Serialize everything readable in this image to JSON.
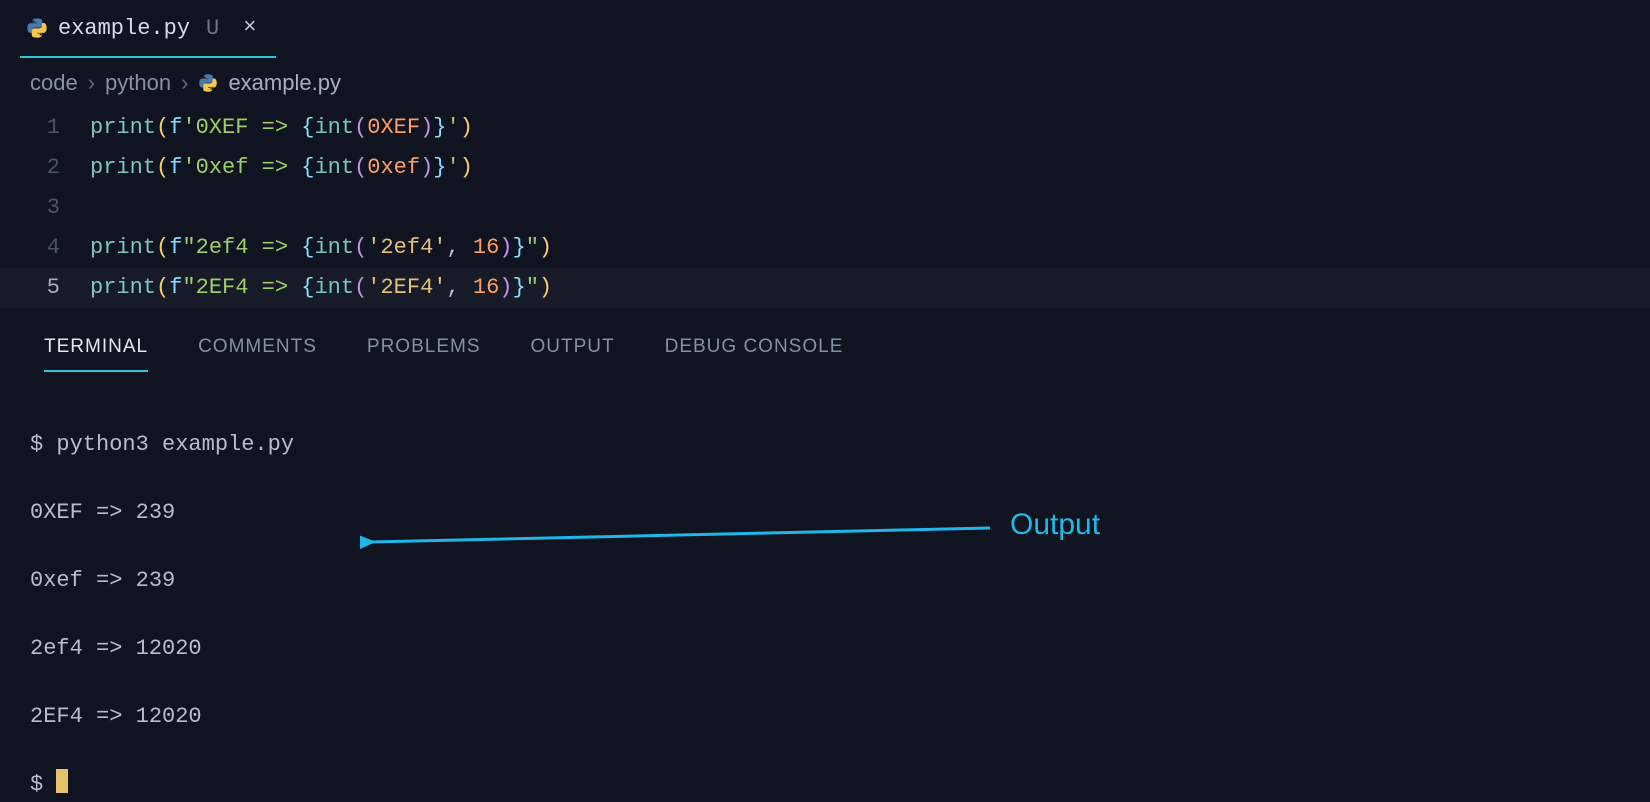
{
  "tab": {
    "filename": "example.py",
    "status": "U"
  },
  "breadcrumbs": {
    "seg0": "code",
    "seg1": "python",
    "seg2": "example.py"
  },
  "editor": {
    "lines": [
      {
        "n": "1"
      },
      {
        "n": "2"
      },
      {
        "n": "3"
      },
      {
        "n": "4"
      },
      {
        "n": "5"
      }
    ],
    "l1": {
      "fn1": "print",
      "pfx": "f",
      "q": "'",
      "s1": "0XEF ",
      "ar": "=>",
      "s2": " ",
      "fn2": "int",
      "arg": "0XEF"
    },
    "l2": {
      "fn1": "print",
      "pfx": "f",
      "q": "'",
      "s1": "0xef ",
      "ar": "=>",
      "s2": " ",
      "fn2": "int",
      "arg": "0xef"
    },
    "l4": {
      "fn1": "print",
      "pfx": "f",
      "q": "\"",
      "s1": "2ef4 ",
      "ar": "=>",
      "s2": " ",
      "fn2": "int",
      "argq": "'2ef4'",
      "base": "16"
    },
    "l5": {
      "fn1": "print",
      "pfx": "f",
      "q": "\"",
      "s1": "2EF4 ",
      "ar": "=>",
      "s2": " ",
      "fn2": "int",
      "argq": "'2EF4'",
      "base": "16"
    }
  },
  "panel": {
    "tabs": {
      "terminal": "TERMINAL",
      "comments": "COMMENTS",
      "problems": "PROBLEMS",
      "output": "OUTPUT",
      "debug": "DEBUG CONSOLE"
    }
  },
  "terminal": {
    "cmd": "$ python3 example.py",
    "o1": "0XEF => 239",
    "o2": "0xef => 239",
    "o3": "2ef4 => 12020",
    "o4": "2EF4 => 12020",
    "prompt": "$ "
  },
  "annotation": {
    "label": "Output"
  }
}
